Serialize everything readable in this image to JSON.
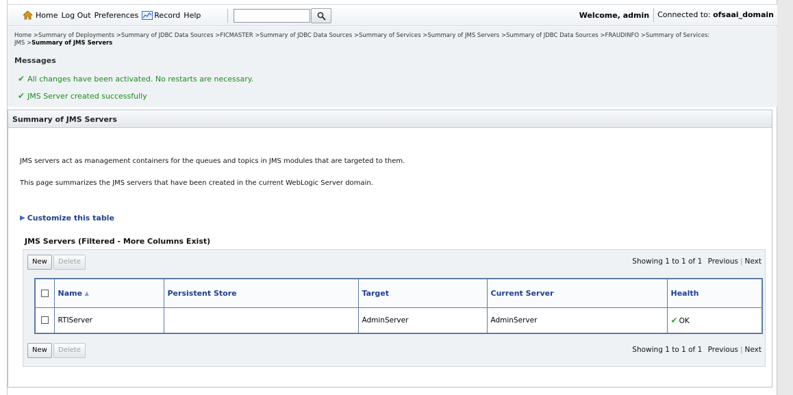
{
  "toolbar": {
    "home": "Home",
    "logout": "Log Out",
    "preferences": "Preferences",
    "record": "Record",
    "help": "Help",
    "search_value": "",
    "welcome": "Welcome, admin",
    "connected_prefix": "Connected to:",
    "domain": "ofsaai_domain"
  },
  "breadcrumb": {
    "path": "Home >Summary of Deployments >Summary of JDBC Data Sources >FICMASTER >Summary of JDBC Data Sources >Summary of Services >Summary of JMS Servers >Summary of JDBC Data Sources >FRAUDINFO >Summary of Services: JMS >",
    "current": "Summary of JMS Servers"
  },
  "messages": {
    "title": "Messages",
    "items": [
      "All changes have been activated. No restarts are necessary.",
      "JMS Server created successfully"
    ]
  },
  "panel": {
    "title": "Summary of JMS Servers",
    "description1": "JMS servers act as management containers for the queues and topics in JMS modules that are targeted to them.",
    "description2": "This page summarizes the JMS servers that have been created in the current WebLogic Server domain.",
    "customize": "Customize this table",
    "table_title": "JMS Servers (Filtered - More Columns Exist)"
  },
  "table": {
    "new_label": "New",
    "delete_label": "Delete",
    "showing": "Showing 1 to 1 of 1",
    "previous": "Previous",
    "next": "Next",
    "columns": [
      "Name",
      "Persistent Store",
      "Target",
      "Current Server",
      "Health"
    ],
    "rows": [
      {
        "name": "RTIServer",
        "persistent_store": "",
        "target": "AdminServer",
        "current_server": "AdminServer",
        "health": "OK"
      }
    ]
  },
  "icons": {
    "home": "home-icon",
    "record": "record-icon",
    "search": "search-icon",
    "success": "checkmark-icon",
    "expand": "triangle-right-icon",
    "sort": "sort-ascending-icon"
  },
  "colors": {
    "link": "#1c3f94",
    "success": "#2ea52e",
    "table_border": "#5d7ba3",
    "message_bg": "#eef2f4"
  }
}
